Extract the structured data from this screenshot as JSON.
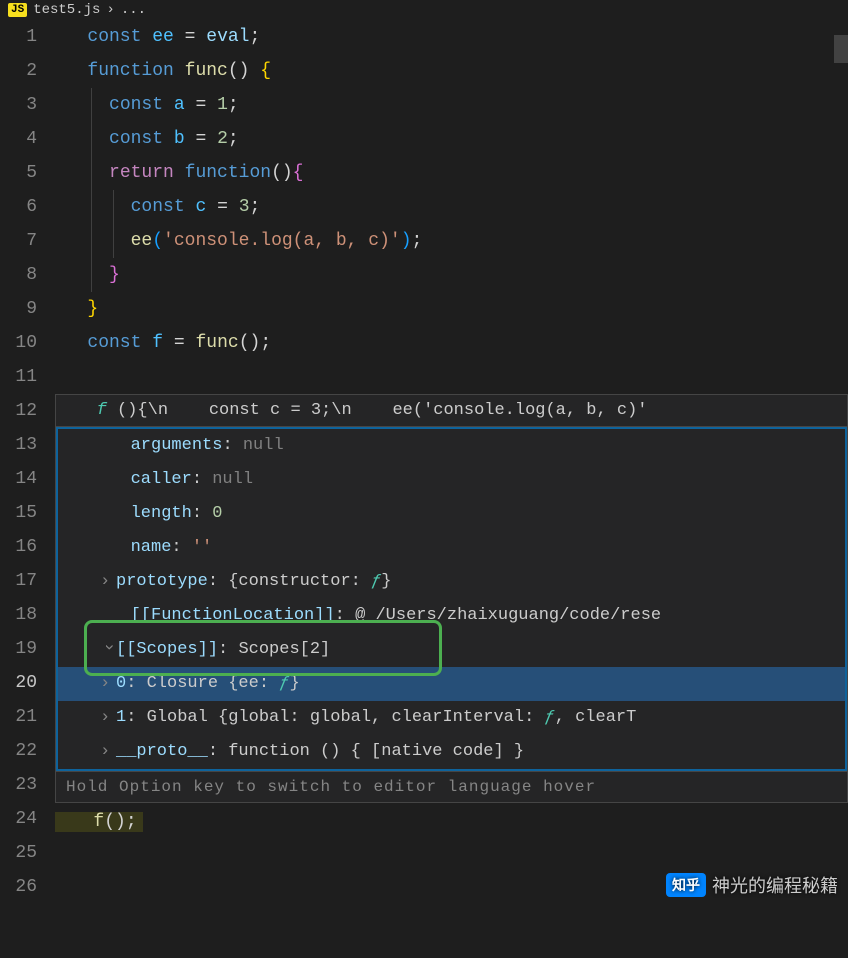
{
  "breadcrumb": {
    "icon_text": "JS",
    "filename": "test5.js",
    "separator": "›",
    "rest": "..."
  },
  "gutter": {
    "lines": [
      "1",
      "2",
      "3",
      "4",
      "5",
      "6",
      "7",
      "8",
      "9",
      "10",
      "11",
      "12",
      "13",
      "14",
      "15",
      "16",
      "17",
      "18",
      "19",
      "20",
      "21",
      "22",
      "23",
      "24",
      "25",
      "26"
    ],
    "current": "20"
  },
  "code": {
    "l1_const": "const",
    "l1_var": "ee",
    "l1_eq": "=",
    "l1_val": "eval",
    "l1_semi": ";",
    "l2_function": "function",
    "l2_name": "func",
    "l2_parens": "()",
    "l2_brace": "{",
    "l3_const": "const",
    "l3_var": "a",
    "l3_eq": "=",
    "l3_val": "1",
    "l3_semi": ";",
    "l4_const": "const",
    "l4_var": "b",
    "l4_eq": "=",
    "l4_val": "2",
    "l4_semi": ";",
    "l5_return": "return",
    "l5_function": "function",
    "l5_parens": "()",
    "l5_brace": "{",
    "l6_const": "const",
    "l6_var": "c",
    "l6_eq": "=",
    "l6_val": "3",
    "l6_semi": ";",
    "l7_func": "ee",
    "l7_paren_open": "(",
    "l7_str": "'console.log(a, b, c)'",
    "l7_paren_close": ")",
    "l7_semi": ";",
    "l8_brace": "}",
    "l9_brace": "}",
    "l10_const": "const",
    "l10_var": "f",
    "l10_eq": "=",
    "l10_func": "func",
    "l10_parens": "()",
    "l10_semi": ";",
    "l25_func": "f",
    "l25_parens": "()",
    "l25_semi": ";"
  },
  "hover": {
    "header_f": "f",
    "header_rest": " (){\\n    const c = 3;\\n    ee('console.log(a, b, c)'",
    "rows": {
      "arguments_key": "arguments",
      "arguments_val": "null",
      "caller_key": "caller",
      "caller_val": "null",
      "length_key": "length",
      "length_val": "0",
      "name_key": "name",
      "name_val": "''",
      "prototype_key": "prototype",
      "prototype_val_pre": "{constructor: ",
      "prototype_val_f": "ƒ",
      "prototype_val_post": "}",
      "funcLoc_key": "[[FunctionLocation]]",
      "funcLoc_val": "@ /Users/zhaixuguang/code/rese",
      "scopes_key": "[[Scopes]]",
      "scopes_val": "Scopes[2]",
      "scope0_key": "0",
      "scope0_val_pre": "Closure {ee: ",
      "scope0_val_f": "ƒ",
      "scope0_val_post": "}",
      "scope1_key": "1",
      "scope1_val_pre": "Global {global: global, clearInterval: ",
      "scope1_val_f": "ƒ",
      "scope1_val_post": ", clearT",
      "proto_key": "__proto__",
      "proto_val": "function () { [native code] }"
    },
    "hint": "Hold Option key to switch to editor language hover"
  },
  "watermark": {
    "zhihu": "知乎",
    "text": "神光的编程秘籍"
  }
}
